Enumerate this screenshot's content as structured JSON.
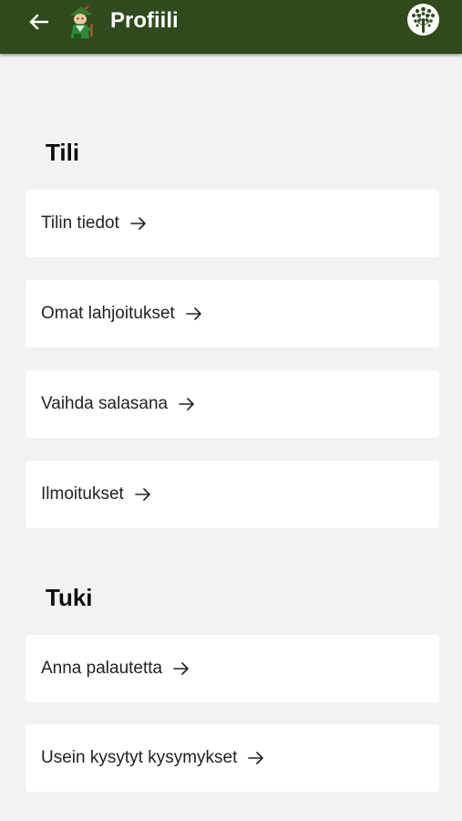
{
  "header": {
    "title": "Profiili",
    "back_icon": "arrow-left-icon",
    "mascot_icon": "mascot-icon",
    "logo_icon": "tree-logo-icon",
    "background_color": "#2f4a1c"
  },
  "sections": [
    {
      "heading": "Tili",
      "items": [
        {
          "label": "Tilin tiedot",
          "icon": "arrow-right-icon"
        },
        {
          "label": "Omat lahjoitukset",
          "icon": "arrow-right-icon"
        },
        {
          "label": "Vaihda salasana",
          "icon": "arrow-right-icon"
        },
        {
          "label": "Ilmoitukset",
          "icon": "arrow-right-icon"
        }
      ]
    },
    {
      "heading": "Tuki",
      "items": [
        {
          "label": "Anna palautetta",
          "icon": "arrow-right-icon"
        },
        {
          "label": "Usein kysytyt kysymykset",
          "icon": "arrow-right-icon"
        }
      ]
    }
  ]
}
